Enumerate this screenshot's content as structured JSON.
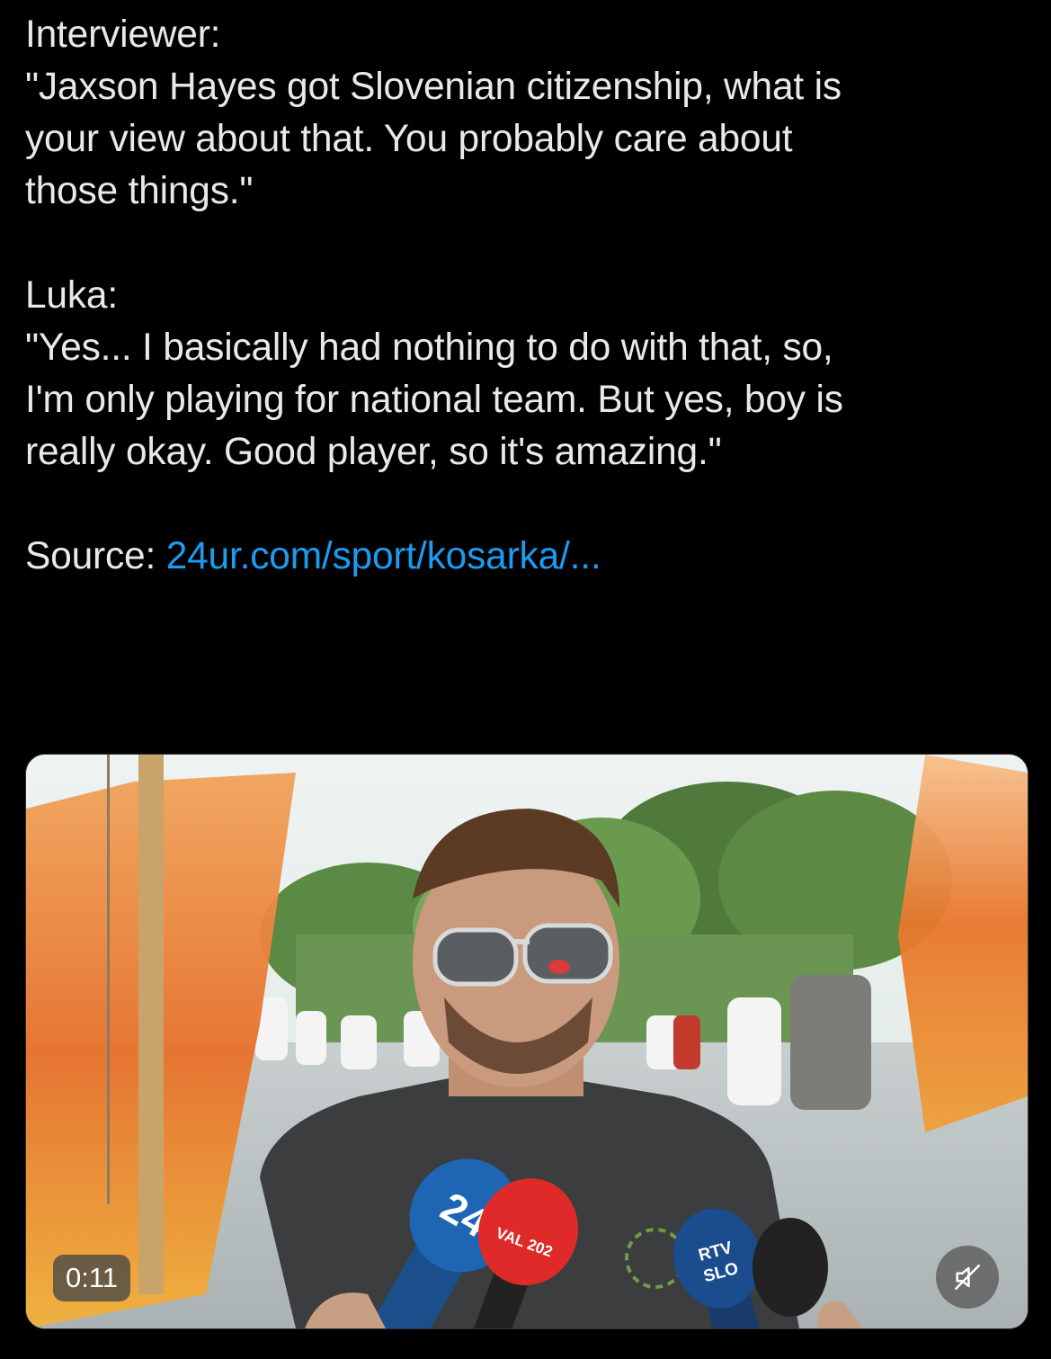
{
  "tweet": {
    "lines": [
      "Interviewer:",
      "\"Jaxson Hayes got Slovenian citizenship, what is",
      "your view about that. You probably care about",
      "those things.\"",
      "Luka:",
      "\"Yes... I basically had nothing to do with that, so,",
      "I'm only playing for national team. But yes, boy is",
      "really okay. Good player, so it's amazing.\""
    ],
    "source_label": "Source: ",
    "source_link": "24ur.com/sport/kosarka/..."
  },
  "video": {
    "duration": "0:11",
    "muted": true,
    "mic_labels": {
      "mic1": "24",
      "mic2": "VAL 202",
      "mic3_line1": "RTV",
      "mic3_line2": "SLO"
    }
  },
  "colors": {
    "background": "#000000",
    "text": "#e7e9ea",
    "link": "#1d9bf0"
  },
  "icons": {
    "mute": "speaker-muted-icon"
  }
}
